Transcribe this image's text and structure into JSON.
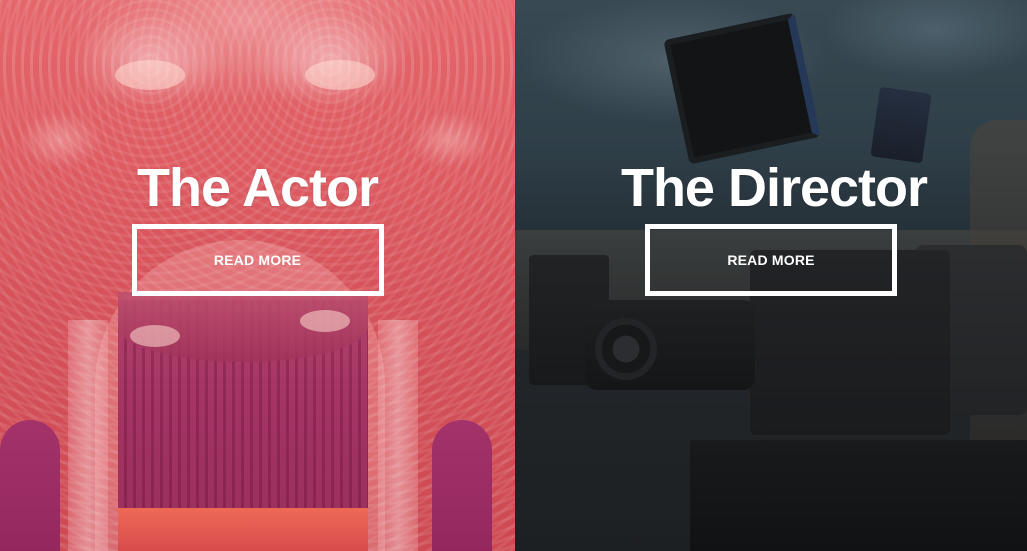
{
  "cards": [
    {
      "title": "The Actor",
      "button_label": "READ MORE",
      "overlay_color": "#e0585e",
      "background_image": "theatre-interior-image"
    },
    {
      "title": "The Director",
      "button_label": "READ MORE",
      "overlay_color": "#23272a",
      "background_image": "cinema-camera-image"
    }
  ],
  "colors": {
    "text": "#ffffff",
    "button_border": "#ffffff"
  }
}
